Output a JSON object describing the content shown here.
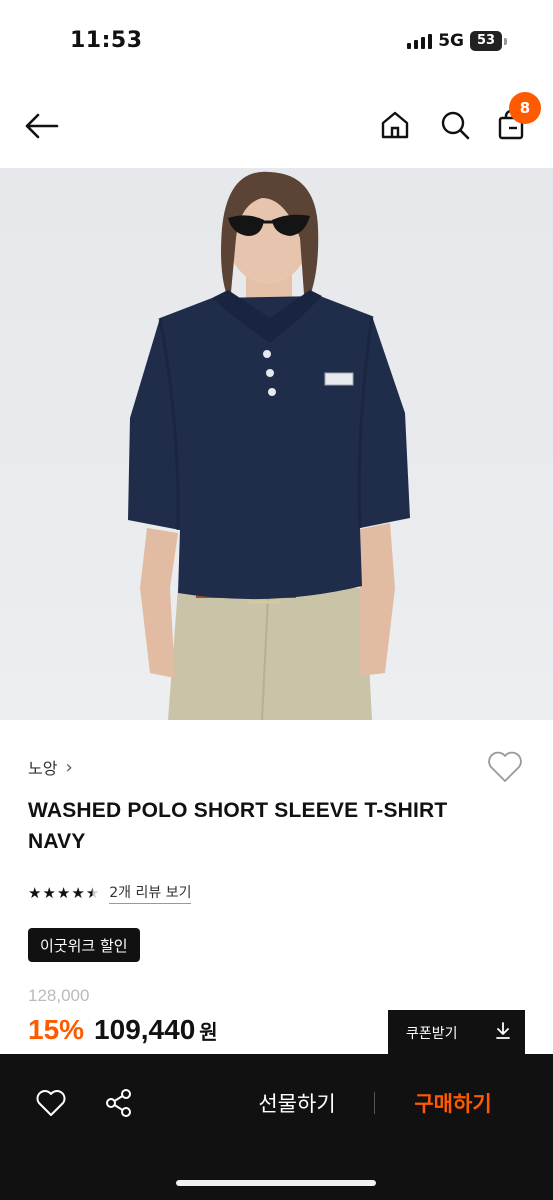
{
  "status_bar": {
    "time": "11:53",
    "network": "5G",
    "battery": "53"
  },
  "nav": {
    "back_icon": "arrow-left-icon",
    "home_icon": "home-icon",
    "search_icon": "search-icon",
    "cart_icon": "shopping-bag-icon",
    "cart_count": "8"
  },
  "hero_image": {
    "subject": "product-photo"
  },
  "product": {
    "brand": "노앙",
    "brand_chevron": "›",
    "title": "WASHED POLO SHORT SLEEVE T-SHIRT NAVY",
    "rating": 4.5,
    "review_link": "2개 리뷰 보기",
    "promo_badge": "이굿위크 할인",
    "original_price": "128,000",
    "discount_rate": "15%",
    "sale_price": "109,440",
    "currency": "원"
  },
  "coupon": {
    "label": "쿠폰받기",
    "icon": "download-icon"
  },
  "bottom_bar": {
    "wish_icon": "heart-icon",
    "share_icon": "share-icon",
    "gift_label": "선물하기",
    "buy_label": "구매하기"
  },
  "colors": {
    "accent": "#ff5a00",
    "bottom_bar_bg": "#111111",
    "shirt_navy": "#1f2d4b"
  }
}
